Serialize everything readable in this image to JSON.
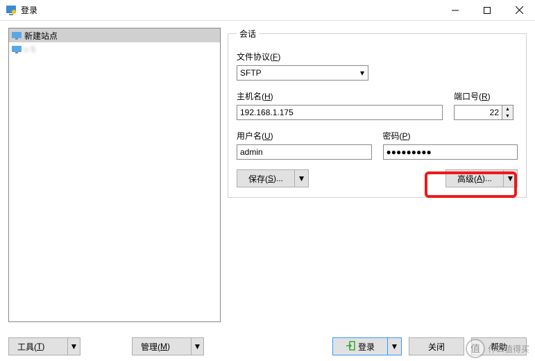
{
  "window": {
    "title": "登录"
  },
  "sidebar": {
    "items": [
      {
        "label": "新建站点"
      },
      {
        "label": "c                            5"
      }
    ]
  },
  "session": {
    "legend": "会话",
    "protocol_label_pre": "文件协议(",
    "protocol_label_key": "F",
    "protocol_label_post": ")",
    "protocol_value": "SFTP",
    "host_label_pre": "主机名(",
    "host_label_key": "H",
    "host_label_post": ")",
    "host_value": "192.168.1.175",
    "port_label_pre": "端口号(",
    "port_label_key": "R",
    "port_label_post": ")",
    "port_value": "22",
    "user_label_pre": "用户名(",
    "user_label_key": "U",
    "user_label_post": ")",
    "user_value": "admin",
    "pass_label_pre": "密码(",
    "pass_label_key": "P",
    "pass_label_post": ")",
    "pass_value": "●●●●●●●●●",
    "save_btn_pre": "保存(",
    "save_btn_key": "S",
    "save_btn_post": ")...",
    "adv_btn_pre": "高级(",
    "adv_btn_key": "A",
    "adv_btn_post": ")..."
  },
  "footer": {
    "tools_pre": "工具(",
    "tools_key": "T",
    "tools_post": ")",
    "manage_pre": "管理(",
    "manage_key": "M",
    "manage_post": ")",
    "login": "登录",
    "close": "关闭",
    "help": "帮助"
  },
  "watermark": {
    "char": "值",
    "text": "什么值得买"
  }
}
